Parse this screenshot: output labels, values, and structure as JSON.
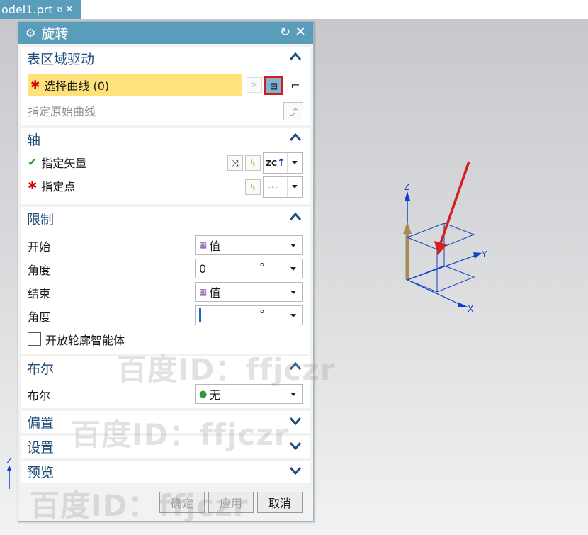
{
  "file_tab": {
    "name": "odel1.prt",
    "pin": "⧉",
    "close": "✕"
  },
  "dialog": {
    "title": "旋转",
    "sections": {
      "surface": {
        "header": "表区域驱动",
        "select_curve": "选择曲线 (0)",
        "specify_original": "指定原始曲线"
      },
      "axis": {
        "header": "轴",
        "specify_vector": "指定矢量",
        "vector_value": "ZC",
        "specify_point": "指定点"
      },
      "limits": {
        "header": "限制",
        "start_label": "开始",
        "start_value": "值",
        "angle1_label": "角度",
        "angle1_value": "0",
        "angle1_unit": "°",
        "end_label": "结束",
        "end_value": "值",
        "angle2_label": "角度",
        "angle2_value": "",
        "angle2_unit": "°",
        "open_profile": "开放轮廓智能体"
      },
      "boolean": {
        "header": "布尔",
        "label": "布尔",
        "value": "无"
      },
      "offset": {
        "header": "偏置"
      },
      "settings": {
        "header": "设置"
      },
      "preview": {
        "header": "预览"
      }
    },
    "buttons": {
      "ok": "确定",
      "apply": "应用",
      "cancel": "取消"
    }
  },
  "viewport": {
    "axes": {
      "z": "Z",
      "y": "Y",
      "x": "X"
    },
    "corner_axis": "Z"
  },
  "watermarks": [
    "百度ID：ffjczr",
    "百度ID：ffjczr",
    "百度ID：ffjczr"
  ],
  "colors": {
    "title_bar": "#5a9dbb",
    "highlight": "#ffe27a",
    "required": "#d60000",
    "annotation_arrow": "#d42020"
  }
}
